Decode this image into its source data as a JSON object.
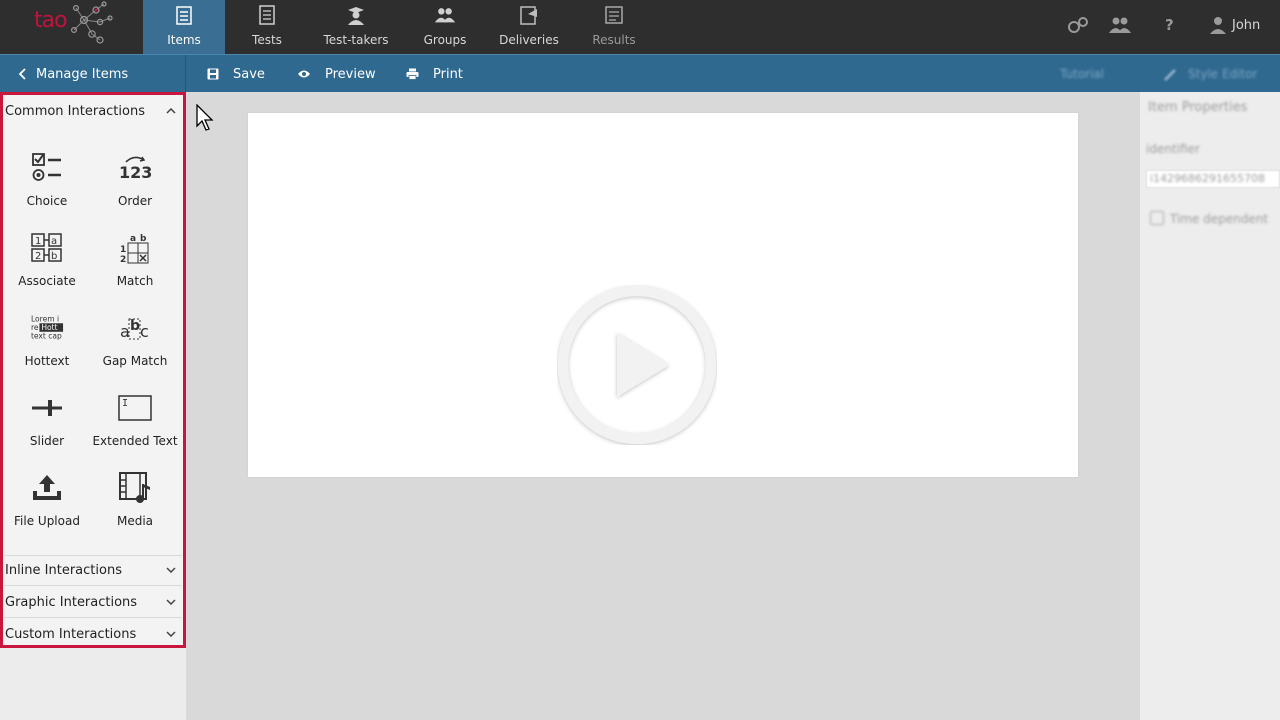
{
  "brand": {
    "logo_text": "tao",
    "accent": "#c8163f",
    "nav_active": "#3a6f93",
    "toolbar_bg": "#2f6990"
  },
  "nav": {
    "items": [
      {
        "label": "Items",
        "icon": "items-icon"
      },
      {
        "label": "Tests",
        "icon": "tests-icon"
      },
      {
        "label": "Test-takers",
        "icon": "test-takers-icon"
      },
      {
        "label": "Groups",
        "icon": "groups-icon"
      },
      {
        "label": "Deliveries",
        "icon": "deliveries-icon"
      },
      {
        "label": "Results",
        "icon": "results-icon"
      }
    ],
    "user": "John"
  },
  "toolbar": {
    "back_label": "Manage Items",
    "save_label": "Save",
    "preview_label": "Preview",
    "print_label": "Print",
    "tutorial_label": "Tutorial",
    "style_editor_label": "Style Editor"
  },
  "sidebar": {
    "common_header": "Common Interactions",
    "tools": [
      {
        "label": "Choice",
        "icon": "choice-icon"
      },
      {
        "label": "Order",
        "icon": "order-icon"
      },
      {
        "label": "Associate",
        "icon": "associate-icon"
      },
      {
        "label": "Match",
        "icon": "match-icon"
      },
      {
        "label": "Hottext",
        "icon": "hottext-icon"
      },
      {
        "label": "Gap Match",
        "icon": "gap-match-icon"
      },
      {
        "label": "Slider",
        "icon": "slider-icon"
      },
      {
        "label": "Extended Text",
        "icon": "extended-text-icon"
      },
      {
        "label": "File Upload",
        "icon": "file-upload-icon"
      },
      {
        "label": "Media",
        "icon": "media-icon"
      }
    ],
    "inline_header": "Inline Interactions",
    "graphic_header": "Graphic Interactions",
    "custom_header": "Custom Interactions"
  },
  "properties": {
    "title": "Item Properties",
    "identifier_label": "identifier",
    "identifier_value": "i1429686291655708",
    "time_dependent_label": "Time dependent"
  }
}
